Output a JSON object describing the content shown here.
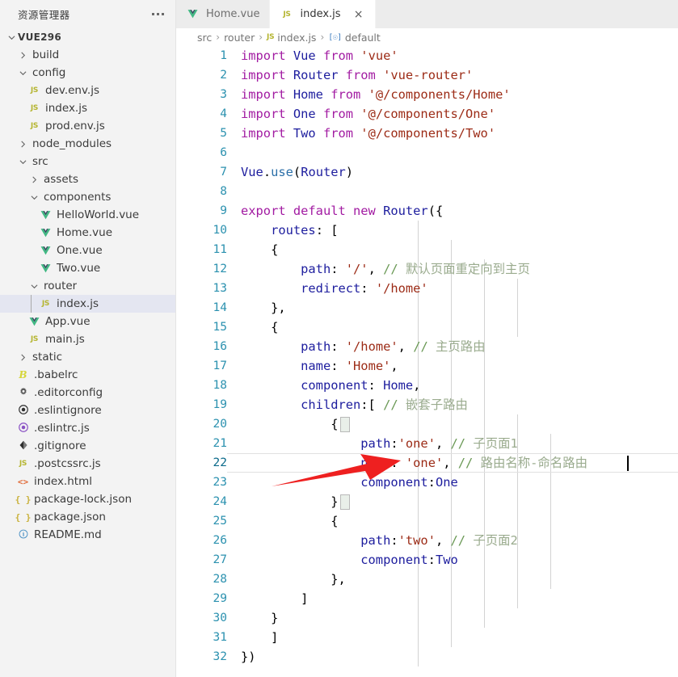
{
  "sidebar": {
    "title": "资源管理器",
    "more_label": "...",
    "root": "VUE296",
    "items": [
      {
        "label": "build",
        "type": "folder",
        "state": "collapsed",
        "indent": 1
      },
      {
        "label": "config",
        "type": "folder",
        "state": "expanded",
        "indent": 1
      },
      {
        "label": "dev.env.js",
        "type": "js",
        "indent": 2
      },
      {
        "label": "index.js",
        "type": "js",
        "indent": 2
      },
      {
        "label": "prod.env.js",
        "type": "js",
        "indent": 2
      },
      {
        "label": "node_modules",
        "type": "folder",
        "state": "collapsed",
        "indent": 1
      },
      {
        "label": "src",
        "type": "folder",
        "state": "expanded",
        "indent": 1
      },
      {
        "label": "assets",
        "type": "folder",
        "state": "collapsed",
        "indent": 2
      },
      {
        "label": "components",
        "type": "folder",
        "state": "expanded",
        "indent": 2
      },
      {
        "label": "HelloWorld.vue",
        "type": "vue",
        "indent": 3
      },
      {
        "label": "Home.vue",
        "type": "vue",
        "indent": 3
      },
      {
        "label": "One.vue",
        "type": "vue",
        "indent": 3
      },
      {
        "label": "Two.vue",
        "type": "vue",
        "indent": 3
      },
      {
        "label": "router",
        "type": "folder",
        "state": "expanded",
        "indent": 2
      },
      {
        "label": "index.js",
        "type": "js",
        "indent": 3,
        "selected": true
      },
      {
        "label": "App.vue",
        "type": "vue",
        "indent": 2
      },
      {
        "label": "main.js",
        "type": "js",
        "indent": 2
      },
      {
        "label": "static",
        "type": "folder",
        "state": "collapsed",
        "indent": 1
      },
      {
        "label": ".babelrc",
        "type": "babel",
        "indent": 1
      },
      {
        "label": ".editorconfig",
        "type": "gear",
        "indent": 1
      },
      {
        "label": ".eslintignore",
        "type": "eslint-dark",
        "indent": 1
      },
      {
        "label": ".eslintrc.js",
        "type": "eslint",
        "indent": 1
      },
      {
        "label": ".gitignore",
        "type": "git",
        "indent": 1
      },
      {
        "label": ".postcssrc.js",
        "type": "js",
        "indent": 1
      },
      {
        "label": "index.html",
        "type": "html",
        "indent": 1
      },
      {
        "label": "package-lock.json",
        "type": "json",
        "indent": 1
      },
      {
        "label": "package.json",
        "type": "json",
        "indent": 1
      },
      {
        "label": "README.md",
        "type": "md",
        "indent": 1
      }
    ]
  },
  "tabs": [
    {
      "label": "Home.vue",
      "type": "vue",
      "active": false,
      "closable": false
    },
    {
      "label": "index.js",
      "type": "js",
      "active": true,
      "closable": true,
      "close_label": "×"
    }
  ],
  "breadcrumb": {
    "sep": "›",
    "items": [
      {
        "label": "src",
        "icon": null
      },
      {
        "label": "router",
        "icon": null
      },
      {
        "label": "index.js",
        "icon": "js-icon"
      },
      {
        "label": "default",
        "icon": "symbol-icon"
      }
    ]
  },
  "editor": {
    "language": "javascript",
    "file": "index.js",
    "total_lines": 32,
    "current_line": 22,
    "cursor_column": 33,
    "lines": [
      {
        "n": 1,
        "tokens": [
          {
            "t": "import ",
            "c": "k"
          },
          {
            "t": "Vue ",
            "c": "id"
          },
          {
            "t": "from ",
            "c": "k"
          },
          {
            "t": "'vue'",
            "c": "str"
          }
        ]
      },
      {
        "n": 2,
        "tokens": [
          {
            "t": "import ",
            "c": "k"
          },
          {
            "t": "Router ",
            "c": "id"
          },
          {
            "t": "from ",
            "c": "k"
          },
          {
            "t": "'vue-router'",
            "c": "str"
          }
        ]
      },
      {
        "n": 3,
        "tokens": [
          {
            "t": "import ",
            "c": "k"
          },
          {
            "t": "Home ",
            "c": "id"
          },
          {
            "t": "from ",
            "c": "k"
          },
          {
            "t": "'@/components/Home'",
            "c": "str"
          }
        ]
      },
      {
        "n": 4,
        "tokens": [
          {
            "t": "import ",
            "c": "k"
          },
          {
            "t": "One ",
            "c": "id"
          },
          {
            "t": "from ",
            "c": "k"
          },
          {
            "t": "'@/components/One'",
            "c": "str"
          }
        ]
      },
      {
        "n": 5,
        "tokens": [
          {
            "t": "import ",
            "c": "k"
          },
          {
            "t": "Two ",
            "c": "id"
          },
          {
            "t": "from ",
            "c": "k"
          },
          {
            "t": "'@/components/Two'",
            "c": "str"
          }
        ]
      },
      {
        "n": 6,
        "tokens": []
      },
      {
        "n": 7,
        "tokens": [
          {
            "t": "Vue",
            "c": "id"
          },
          {
            "t": ".",
            "c": "pn"
          },
          {
            "t": "use",
            "c": "fn"
          },
          {
            "t": "(",
            "c": "pn"
          },
          {
            "t": "Router",
            "c": "id"
          },
          {
            "t": ")",
            "c": "pn"
          }
        ]
      },
      {
        "n": 8,
        "tokens": []
      },
      {
        "n": 9,
        "tokens": [
          {
            "t": "export ",
            "c": "k"
          },
          {
            "t": "default ",
            "c": "k"
          },
          {
            "t": "new ",
            "c": "k"
          },
          {
            "t": "Router",
            "c": "id"
          },
          {
            "t": "({",
            "c": "pn"
          }
        ]
      },
      {
        "n": 10,
        "tokens": [
          {
            "t": "    ",
            "c": "pn"
          },
          {
            "t": "routes",
            "c": "id"
          },
          {
            "t": ": [",
            "c": "pn"
          }
        ]
      },
      {
        "n": 11,
        "tokens": [
          {
            "t": "    {",
            "c": "pn"
          }
        ]
      },
      {
        "n": 12,
        "tokens": [
          {
            "t": "        ",
            "c": "pn"
          },
          {
            "t": "path",
            "c": "id"
          },
          {
            "t": ": ",
            "c": "pn"
          },
          {
            "t": "'/'",
            "c": "str"
          },
          {
            "t": ", ",
            "c": "pn"
          },
          {
            "t": "// ",
            "c": "cm"
          },
          {
            "t": "默认页面重定向到主页",
            "c": "cmz"
          }
        ]
      },
      {
        "n": 13,
        "tokens": [
          {
            "t": "        ",
            "c": "pn"
          },
          {
            "t": "redirect",
            "c": "id"
          },
          {
            "t": ": ",
            "c": "pn"
          },
          {
            "t": "'/home'",
            "c": "str"
          }
        ]
      },
      {
        "n": 14,
        "tokens": [
          {
            "t": "    },",
            "c": "pn"
          }
        ]
      },
      {
        "n": 15,
        "tokens": [
          {
            "t": "    {",
            "c": "pn"
          }
        ]
      },
      {
        "n": 16,
        "tokens": [
          {
            "t": "        ",
            "c": "pn"
          },
          {
            "t": "path",
            "c": "id"
          },
          {
            "t": ": ",
            "c": "pn"
          },
          {
            "t": "'/home'",
            "c": "str"
          },
          {
            "t": ", ",
            "c": "pn"
          },
          {
            "t": "// ",
            "c": "cm"
          },
          {
            "t": "主页路由",
            "c": "cmz"
          }
        ]
      },
      {
        "n": 17,
        "tokens": [
          {
            "t": "        ",
            "c": "pn"
          },
          {
            "t": "name",
            "c": "id"
          },
          {
            "t": ": ",
            "c": "pn"
          },
          {
            "t": "'Home'",
            "c": "str"
          },
          {
            "t": ",",
            "c": "pn"
          }
        ]
      },
      {
        "n": 18,
        "tokens": [
          {
            "t": "        ",
            "c": "pn"
          },
          {
            "t": "component",
            "c": "id"
          },
          {
            "t": ": ",
            "c": "pn"
          },
          {
            "t": "Home",
            "c": "id"
          },
          {
            "t": ",",
            "c": "pn"
          }
        ]
      },
      {
        "n": 19,
        "tokens": [
          {
            "t": "        ",
            "c": "pn"
          },
          {
            "t": "children",
            "c": "id"
          },
          {
            "t": ":[ ",
            "c": "pn"
          },
          {
            "t": "// ",
            "c": "cm"
          },
          {
            "t": "嵌套子路由",
            "c": "cmz"
          }
        ]
      },
      {
        "n": 20,
        "tokens": [
          {
            "t": "            {",
            "c": "pn"
          }
        ]
      },
      {
        "n": 21,
        "tokens": [
          {
            "t": "                ",
            "c": "pn"
          },
          {
            "t": "path",
            "c": "id"
          },
          {
            "t": ":",
            "c": "pn"
          },
          {
            "t": "'one'",
            "c": "str"
          },
          {
            "t": ", ",
            "c": "pn"
          },
          {
            "t": "// ",
            "c": "cm"
          },
          {
            "t": "子页面1",
            "c": "cmz"
          }
        ]
      },
      {
        "n": 22,
        "tokens": [
          {
            "t": "                ",
            "c": "pn"
          },
          {
            "t": "name",
            "c": "id"
          },
          {
            "t": ": ",
            "c": "pn"
          },
          {
            "t": "'one'",
            "c": "str"
          },
          {
            "t": ", ",
            "c": "pn"
          },
          {
            "t": "// ",
            "c": "cm"
          },
          {
            "t": "路由名称-命名路由",
            "c": "cmz"
          }
        ]
      },
      {
        "n": 23,
        "tokens": [
          {
            "t": "                ",
            "c": "pn"
          },
          {
            "t": "component",
            "c": "id"
          },
          {
            "t": ":",
            "c": "pn"
          },
          {
            "t": "One",
            "c": "id"
          }
        ]
      },
      {
        "n": 24,
        "tokens": [
          {
            "t": "            },",
            "c": "pn"
          }
        ]
      },
      {
        "n": 25,
        "tokens": [
          {
            "t": "            {",
            "c": "pn"
          }
        ]
      },
      {
        "n": 26,
        "tokens": [
          {
            "t": "                ",
            "c": "pn"
          },
          {
            "t": "path",
            "c": "id"
          },
          {
            "t": ":",
            "c": "pn"
          },
          {
            "t": "'two'",
            "c": "str"
          },
          {
            "t": ", ",
            "c": "pn"
          },
          {
            "t": "// ",
            "c": "cm"
          },
          {
            "t": "子页面2",
            "c": "cmz"
          }
        ]
      },
      {
        "n": 27,
        "tokens": [
          {
            "t": "                ",
            "c": "pn"
          },
          {
            "t": "component",
            "c": "id"
          },
          {
            "t": ":",
            "c": "pn"
          },
          {
            "t": "Two",
            "c": "id"
          }
        ]
      },
      {
        "n": 28,
        "tokens": [
          {
            "t": "            },",
            "c": "pn"
          }
        ]
      },
      {
        "n": 29,
        "tokens": [
          {
            "t": "        ]",
            "c": "pn"
          }
        ]
      },
      {
        "n": 30,
        "tokens": [
          {
            "t": "    }",
            "c": "pn"
          }
        ]
      },
      {
        "n": 31,
        "tokens": [
          {
            "t": "    ]",
            "c": "pn"
          }
        ]
      },
      {
        "n": 32,
        "tokens": [
          {
            "t": "})",
            "c": "pn"
          }
        ]
      }
    ]
  },
  "annotation": {
    "type": "arrow",
    "color": "#ee2020",
    "points_to_line": 22
  },
  "colors": {
    "sidebar_bg": "#f3f3f3",
    "selected_row": "#e4e6f1",
    "tabbar_bg": "#ececec",
    "editor_bg": "#ffffff",
    "line_number": "#2b91af",
    "keyword": "#a21ba2",
    "identifier": "#1d1d9e",
    "string": "#9c2b16",
    "comment": "#6a9955",
    "arrow": "#ee2020"
  }
}
